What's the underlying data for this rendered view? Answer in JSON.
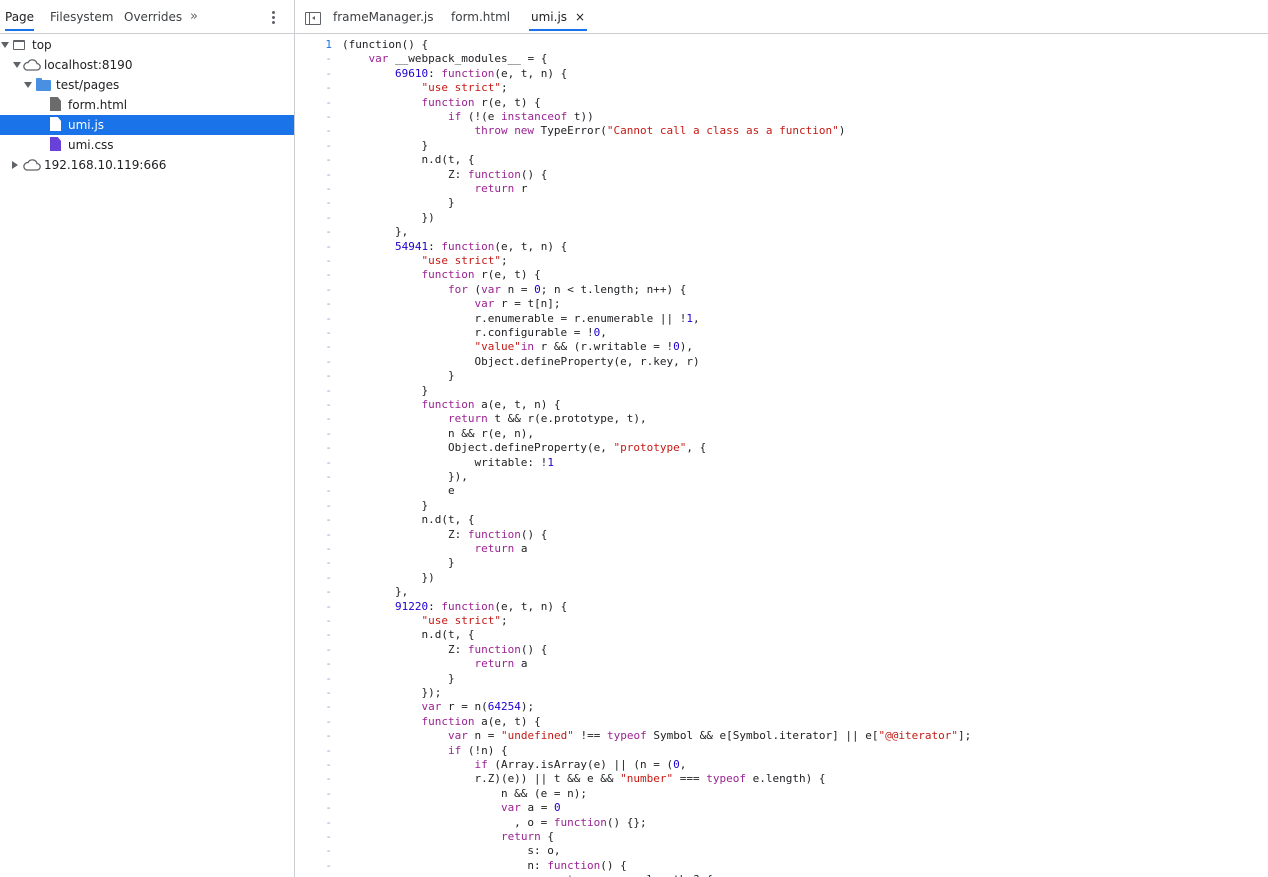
{
  "left_tabs": [
    "Page",
    "Filesystem",
    "Overrides"
  ],
  "more_tabs": "»",
  "editor_tabs": [
    "frameManager.js",
    "form.html",
    "umi.js"
  ],
  "active_editor_tab_close": "×",
  "tree": [
    {
      "label": "top",
      "icon": "frame-icon"
    },
    {
      "label": "localhost:8190",
      "icon": "cloud-icon"
    },
    {
      "label": "test/pages",
      "icon": "folder-icon"
    },
    {
      "label": "form.html",
      "icon": "file-icon"
    },
    {
      "label": "umi.js",
      "icon": "file-icon"
    },
    {
      "label": "umi.css",
      "icon": "file-icon"
    },
    {
      "label": "192.168.10.119:666",
      "icon": "cloud-icon"
    }
  ],
  "colors": {
    "accent": "#1a73e8",
    "keyword": "#9b2393",
    "string": "#c41a16",
    "number": "#1c00cf"
  },
  "code": {
    "first_line_number": "1",
    "gutter_marker": "-",
    "lines": [
      [
        [
          "p",
          "(function() {"
        ]
      ],
      [
        [
          "p",
          "    "
        ],
        [
          "k",
          "var"
        ],
        [
          "p",
          " __webpack_modules__ = {"
        ]
      ],
      [
        [
          "p",
          "        "
        ],
        [
          "n",
          "69610"
        ],
        [
          "p",
          ": "
        ],
        [
          "k",
          "function"
        ],
        [
          "p",
          "(e, t, n) {"
        ]
      ],
      [
        [
          "p",
          "            "
        ],
        [
          "s",
          "\"use strict\""
        ],
        [
          "p",
          ";"
        ]
      ],
      [
        [
          "p",
          "            "
        ],
        [
          "k",
          "function"
        ],
        [
          "p",
          " r(e, t) {"
        ]
      ],
      [
        [
          "p",
          "                "
        ],
        [
          "k",
          "if"
        ],
        [
          "p",
          " (!(e "
        ],
        [
          "k",
          "instanceof"
        ],
        [
          "p",
          " t))"
        ]
      ],
      [
        [
          "p",
          "                    "
        ],
        [
          "k",
          "throw new"
        ],
        [
          "p",
          " TypeError("
        ],
        [
          "s",
          "\"Cannot call a class as a function\""
        ],
        [
          "p",
          ")"
        ]
      ],
      [
        [
          "p",
          "            }"
        ]
      ],
      [
        [
          "p",
          "            n.d(t, {"
        ]
      ],
      [
        [
          "p",
          "                Z: "
        ],
        [
          "k",
          "function"
        ],
        [
          "p",
          "() {"
        ]
      ],
      [
        [
          "p",
          "                    "
        ],
        [
          "k",
          "return"
        ],
        [
          "p",
          " r"
        ]
      ],
      [
        [
          "p",
          "                }"
        ]
      ],
      [
        [
          "p",
          "            })"
        ]
      ],
      [
        [
          "p",
          "        },"
        ]
      ],
      [
        [
          "p",
          "        "
        ],
        [
          "n",
          "54941"
        ],
        [
          "p",
          ": "
        ],
        [
          "k",
          "function"
        ],
        [
          "p",
          "(e, t, n) {"
        ]
      ],
      [
        [
          "p",
          "            "
        ],
        [
          "s",
          "\"use strict\""
        ],
        [
          "p",
          ";"
        ]
      ],
      [
        [
          "p",
          "            "
        ],
        [
          "k",
          "function"
        ],
        [
          "p",
          " r(e, t) {"
        ]
      ],
      [
        [
          "p",
          "                "
        ],
        [
          "k",
          "for"
        ],
        [
          "p",
          " ("
        ],
        [
          "k",
          "var"
        ],
        [
          "p",
          " n = "
        ],
        [
          "n",
          "0"
        ],
        [
          "p",
          "; n < t.length; n++) {"
        ]
      ],
      [
        [
          "p",
          "                    "
        ],
        [
          "k",
          "var"
        ],
        [
          "p",
          " r = t[n];"
        ]
      ],
      [
        [
          "p",
          "                    r.enumerable = r.enumerable || !"
        ],
        [
          "n",
          "1"
        ],
        [
          "p",
          ","
        ]
      ],
      [
        [
          "p",
          "                    r.configurable = !"
        ],
        [
          "n",
          "0"
        ],
        [
          "p",
          ","
        ]
      ],
      [
        [
          "p",
          "                    "
        ],
        [
          "s",
          "\"value\""
        ],
        [
          "k",
          "in"
        ],
        [
          "p",
          " r && (r.writable = !"
        ],
        [
          "n",
          "0"
        ],
        [
          "p",
          "),"
        ]
      ],
      [
        [
          "p",
          "                    Object.defineProperty(e, r.key, r)"
        ]
      ],
      [
        [
          "p",
          "                }"
        ]
      ],
      [
        [
          "p",
          "            }"
        ]
      ],
      [
        [
          "p",
          "            "
        ],
        [
          "k",
          "function"
        ],
        [
          "p",
          " a(e, t, n) {"
        ]
      ],
      [
        [
          "p",
          "                "
        ],
        [
          "k",
          "return"
        ],
        [
          "p",
          " t && r(e.prototype, t),"
        ]
      ],
      [
        [
          "p",
          "                n && r(e, n),"
        ]
      ],
      [
        [
          "p",
          "                Object.defineProperty(e, "
        ],
        [
          "s",
          "\"prototype\""
        ],
        [
          "p",
          ", {"
        ]
      ],
      [
        [
          "p",
          "                    writable: !"
        ],
        [
          "n",
          "1"
        ]
      ],
      [
        [
          "p",
          "                }),"
        ]
      ],
      [
        [
          "p",
          "                e"
        ]
      ],
      [
        [
          "p",
          "            }"
        ]
      ],
      [
        [
          "p",
          "            n.d(t, {"
        ]
      ],
      [
        [
          "p",
          "                Z: "
        ],
        [
          "k",
          "function"
        ],
        [
          "p",
          "() {"
        ]
      ],
      [
        [
          "p",
          "                    "
        ],
        [
          "k",
          "return"
        ],
        [
          "p",
          " a"
        ]
      ],
      [
        [
          "p",
          "                }"
        ]
      ],
      [
        [
          "p",
          "            })"
        ]
      ],
      [
        [
          "p",
          "        },"
        ]
      ],
      [
        [
          "p",
          "        "
        ],
        [
          "n",
          "91220"
        ],
        [
          "p",
          ": "
        ],
        [
          "k",
          "function"
        ],
        [
          "p",
          "(e, t, n) {"
        ]
      ],
      [
        [
          "p",
          "            "
        ],
        [
          "s",
          "\"use strict\""
        ],
        [
          "p",
          ";"
        ]
      ],
      [
        [
          "p",
          "            n.d(t, {"
        ]
      ],
      [
        [
          "p",
          "                Z: "
        ],
        [
          "k",
          "function"
        ],
        [
          "p",
          "() {"
        ]
      ],
      [
        [
          "p",
          "                    "
        ],
        [
          "k",
          "return"
        ],
        [
          "p",
          " a"
        ]
      ],
      [
        [
          "p",
          "                }"
        ]
      ],
      [
        [
          "p",
          "            });"
        ]
      ],
      [
        [
          "p",
          "            "
        ],
        [
          "k",
          "var"
        ],
        [
          "p",
          " r = n("
        ],
        [
          "n",
          "64254"
        ],
        [
          "p",
          ");"
        ]
      ],
      [
        [
          "p",
          "            "
        ],
        [
          "k",
          "function"
        ],
        [
          "p",
          " a(e, t) {"
        ]
      ],
      [
        [
          "p",
          "                "
        ],
        [
          "k",
          "var"
        ],
        [
          "p",
          " n = "
        ],
        [
          "s",
          "\"undefined\""
        ],
        [
          "p",
          " !== "
        ],
        [
          "k",
          "typeof"
        ],
        [
          "p",
          " Symbol && e[Symbol.iterator] || e["
        ],
        [
          "s",
          "\"@@iterator\""
        ],
        [
          "p",
          "];"
        ]
      ],
      [
        [
          "p",
          "                "
        ],
        [
          "k",
          "if"
        ],
        [
          "p",
          " (!n) {"
        ]
      ],
      [
        [
          "p",
          "                    "
        ],
        [
          "k",
          "if"
        ],
        [
          "p",
          " (Array.isArray(e) || (n = ("
        ],
        [
          "n",
          "0"
        ],
        [
          "p",
          ","
        ]
      ],
      [
        [
          "p",
          "                    r.Z)(e)) || t && e && "
        ],
        [
          "s",
          "\"number\""
        ],
        [
          "p",
          " === "
        ],
        [
          "k",
          "typeof"
        ],
        [
          "p",
          " e.length) {"
        ]
      ],
      [
        [
          "p",
          "                        n && (e = n);"
        ]
      ],
      [
        [
          "p",
          "                        "
        ],
        [
          "k",
          "var"
        ],
        [
          "p",
          " a = "
        ],
        [
          "n",
          "0"
        ]
      ],
      [
        [
          "p",
          "                          , o = "
        ],
        [
          "k",
          "function"
        ],
        [
          "p",
          "() {};"
        ]
      ],
      [
        [
          "p",
          "                        "
        ],
        [
          "k",
          "return"
        ],
        [
          "p",
          " {"
        ]
      ],
      [
        [
          "p",
          "                            s: o,"
        ]
      ],
      [
        [
          "p",
          "                            n: "
        ],
        [
          "k",
          "function"
        ],
        [
          "p",
          "() {"
        ]
      ],
      [
        [
          "p",
          "                                "
        ],
        [
          "k",
          "return"
        ],
        [
          "p",
          " a >= e.length ? {"
        ]
      ]
    ]
  }
}
